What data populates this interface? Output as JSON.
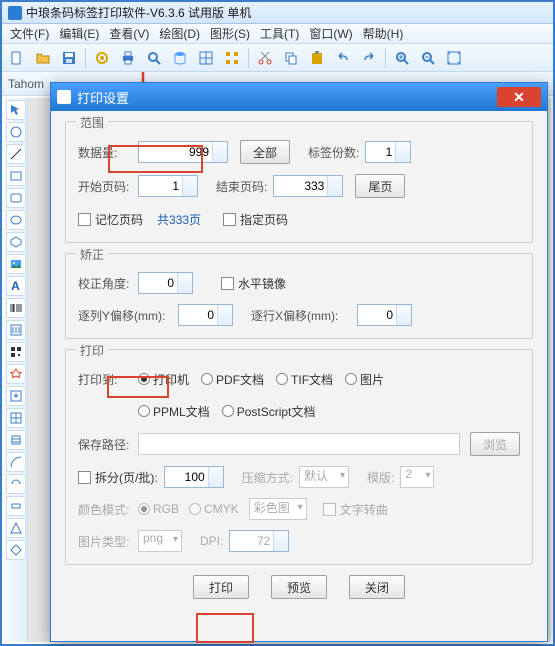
{
  "app": {
    "title": "中琅条码标签打印软件-V6.3.6 试用版 单机"
  },
  "menu": [
    "文件(F)",
    "编辑(E)",
    "查看(V)",
    "绘图(D)",
    "图形(S)",
    "工具(T)",
    "窗口(W)",
    "帮助(H)"
  ],
  "font_box": "Tahom",
  "dialog": {
    "title": "打印设置",
    "close_glyph": "✕",
    "range": {
      "legend": "范围",
      "data_qty_label": "数据量:",
      "data_qty_value": "999",
      "all_btn": "全部",
      "copies_label": "标签份数:",
      "copies_value": "1",
      "start_page_label": "开始页码:",
      "start_page_value": "1",
      "end_page_label": "结束页码:",
      "end_page_value": "333",
      "last_page_btn": "尾页",
      "remember_page": "记忆页码",
      "total_pages": "共333页",
      "specify_page": "指定页码"
    },
    "correct": {
      "legend": "矫正",
      "angle_label": "校正角度:",
      "angle_value": "0",
      "mirror": "水平镜像",
      "col_offset_label": "逐列Y偏移(mm):",
      "col_offset_value": "0",
      "row_offset_label": "逐行X偏移(mm):",
      "row_offset_value": "0"
    },
    "print": {
      "legend": "打印",
      "print_to_label": "打印到:",
      "targets": [
        "打印机",
        "PDF文档",
        "TIF文档",
        "图片",
        "PPML文档",
        "PostScript文档"
      ],
      "selected_target": 0,
      "save_path_label": "保存路径:",
      "browse_btn": "浏览",
      "split_label": "拆分(页/批):",
      "split_value": "100",
      "compress_label": "压缩方式:",
      "compress_value": "默认",
      "template_label": "模版:",
      "template_value": "2",
      "color_mode_label": "颜色模式:",
      "color_modes": [
        "RGB",
        "CMYK"
      ],
      "selected_color": 0,
      "color_profile": "彩色图",
      "text_to_curve": "文字转曲",
      "img_type_label": "图片类型:",
      "img_type_value": "png",
      "dpi_label": "DPI:",
      "dpi_value": "72"
    },
    "buttons": {
      "print": "打印",
      "preview": "预览",
      "close": "关闭"
    }
  },
  "toolbar_icons": [
    "new",
    "open",
    "save",
    "sep",
    "gear",
    "print",
    "preview",
    "db",
    "grid1",
    "grid2",
    "sep",
    "cut",
    "copy",
    "paste",
    "undo",
    "redo",
    "sep",
    "zoom-in",
    "zoom-out",
    "fit"
  ],
  "left_tools": [
    "pointer",
    "hand",
    "line",
    "rect",
    "round-rect",
    "ellipse",
    "polygon",
    "image",
    "text-a",
    "barcode",
    "barcode2",
    "qrcode",
    "star",
    "import",
    "grid-tool",
    "data-tool",
    "arc",
    "shape1",
    "shape2",
    "shape3",
    "shape4"
  ]
}
